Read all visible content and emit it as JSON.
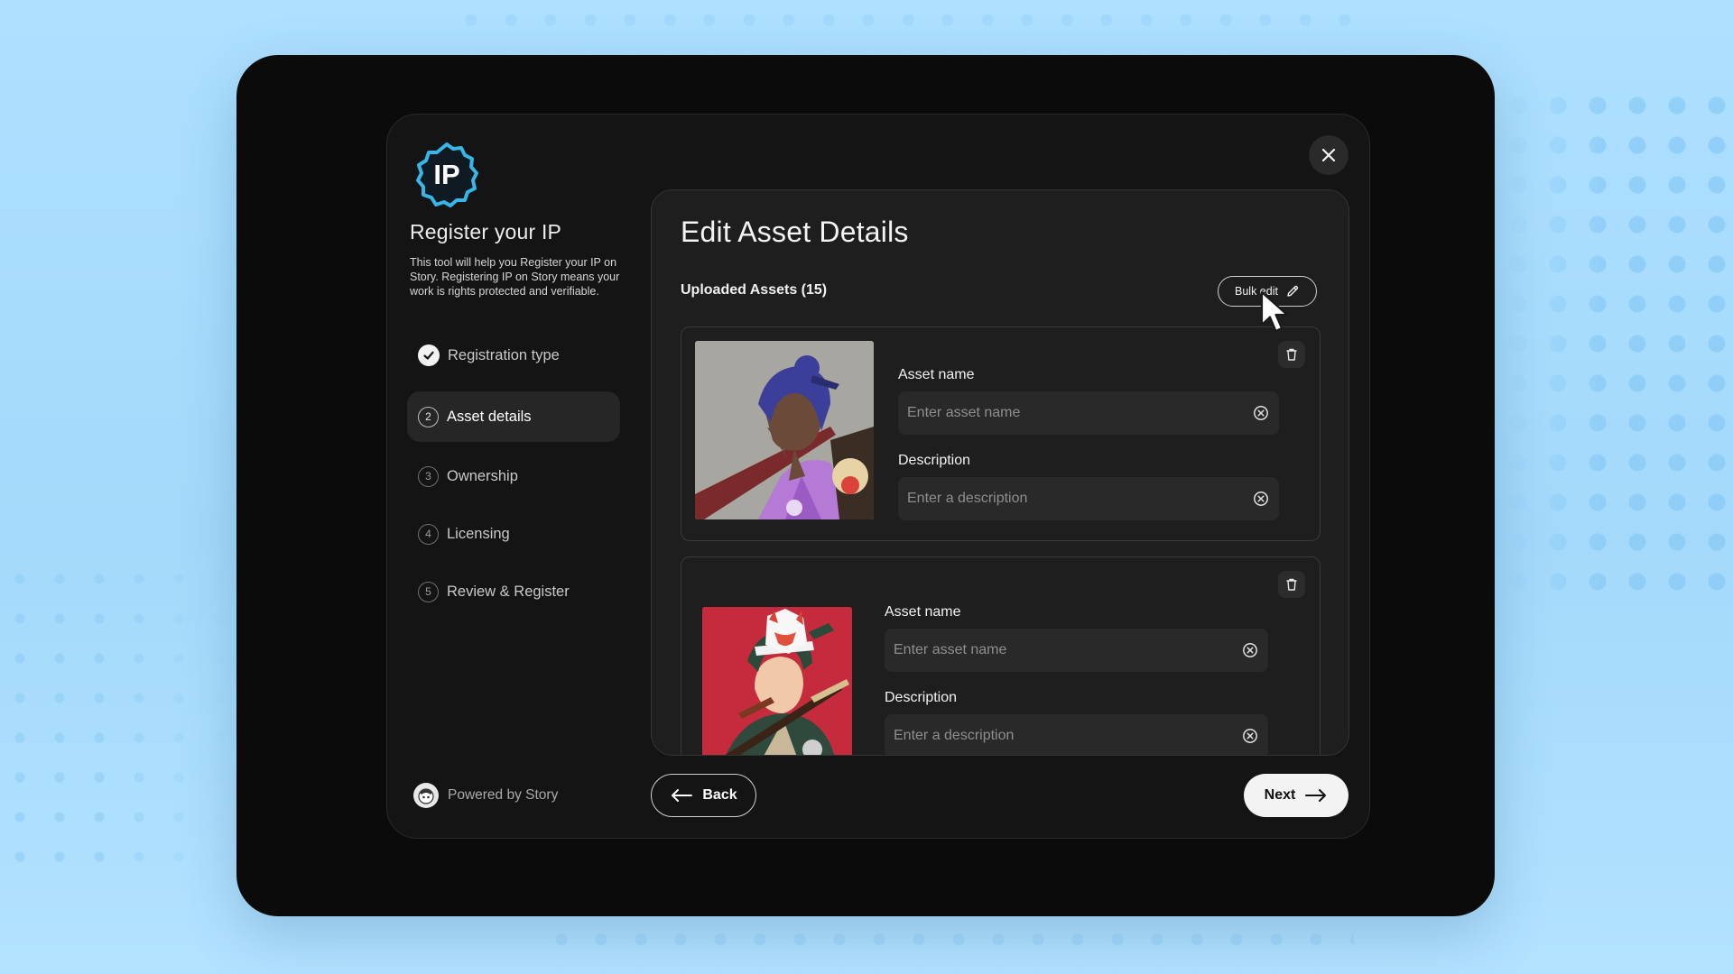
{
  "sidebar": {
    "logo_text": "IP",
    "title": "Register your IP",
    "description": "This tool will help you Register your IP on Story. Registering IP on Story means your work is rights protected and verifiable.",
    "steps": [
      {
        "num": "",
        "label": "Registration type",
        "state": "done"
      },
      {
        "num": "2",
        "label": "Asset details",
        "state": "active"
      },
      {
        "num": "3",
        "label": "Ownership",
        "state": "pending"
      },
      {
        "num": "4",
        "label": "Licensing",
        "state": "pending"
      },
      {
        "num": "5",
        "label": "Review & Register",
        "state": "pending"
      }
    ],
    "powered_by": "Powered by Story"
  },
  "main": {
    "title": "Edit Asset Details",
    "uploaded_label": "Uploaded Assets (15)",
    "bulk_edit_label": "Bulk edit",
    "assets": [
      {
        "name_label": "Asset name",
        "name_placeholder": "Enter asset name",
        "desc_label": "Description",
        "desc_placeholder": "Enter a description"
      },
      {
        "name_label": "Asset name",
        "name_placeholder": "Enter asset name",
        "desc_label": "Description",
        "desc_placeholder": "Enter a description"
      }
    ]
  },
  "footer": {
    "back_label": "Back",
    "next_label": "Next"
  },
  "icons": {
    "close": "close-icon",
    "bulk_edit": "pencil-icon",
    "trash": "trash-icon",
    "clear": "clear-circle-icon",
    "back": "arrow-left-icon",
    "next": "arrow-right-icon",
    "check": "check-icon"
  },
  "colors": {
    "logo_accent": "#37b7e8",
    "page_bg": "#aee0ff",
    "device_bg": "#0b0b0b",
    "panel_bg": "#1e1e1e"
  }
}
